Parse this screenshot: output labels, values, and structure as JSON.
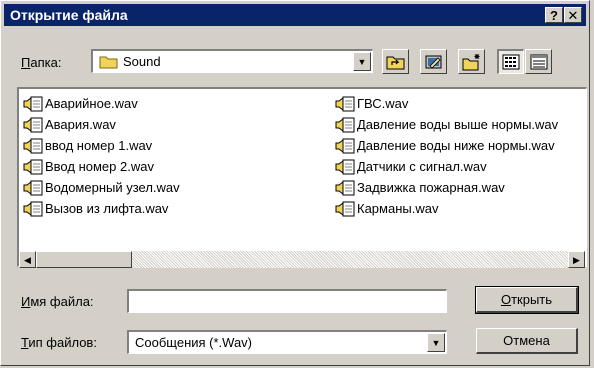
{
  "dialog": {
    "title": "Открытие файла",
    "help_button": "?",
    "close_button": "✕"
  },
  "folder": {
    "label_prefix": "",
    "label_underlined": "П",
    "label_rest": "апка:",
    "value": "Sound"
  },
  "toolbar": {
    "icons": [
      "up-folder-icon",
      "desktop-icon",
      "new-folder-icon",
      "list-view-icon",
      "details-view-icon"
    ]
  },
  "files": {
    "column1": [
      "Аварийное.wav",
      "Авария.wav",
      "ввод номер 1.wav",
      "Ввод номер 2.wav",
      "Водомерный узел.wav",
      "Вызов из лифта.wav"
    ],
    "column2": [
      "ГВС.wav",
      "Давление воды выше нормы.wav",
      "Давление воды ниже нормы.wav",
      "Датчики с сигнал.wav",
      "Задвижка пожарная.wav",
      "Карманы.wav"
    ]
  },
  "filename": {
    "label_underlined": "И",
    "label_rest": "мя файла:",
    "value": ""
  },
  "filetype": {
    "label_underlined": "Т",
    "label_rest": "ип файлов:",
    "value": "Сообщения (*.Wav)"
  },
  "buttons": {
    "open_underlined": "О",
    "open_rest": "ткрыть",
    "cancel": "Отмена"
  },
  "colors": {
    "titlebar": "#0a246a",
    "face": "#d4d0c8",
    "folder_yellow": "#f2d35a"
  }
}
